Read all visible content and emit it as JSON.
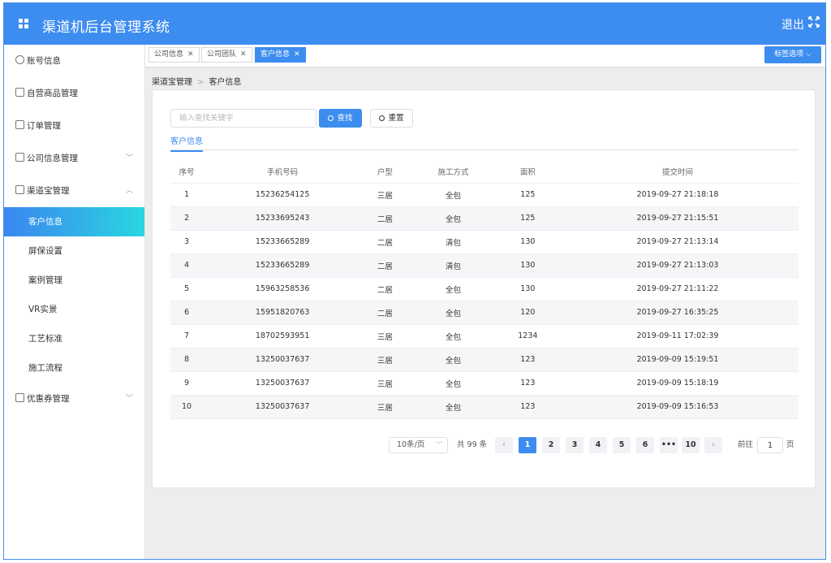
{
  "header": {
    "title": "渠道机后台管理系统",
    "logout_label": "退出"
  },
  "sidebar": {
    "items": [
      {
        "label": "账号信息"
      },
      {
        "label": "自营商品管理"
      },
      {
        "label": "订单管理"
      },
      {
        "label": "公司信息管理"
      },
      {
        "label": "渠道宝管理"
      }
    ],
    "sub_items": [
      {
        "label": "客户信息"
      },
      {
        "label": "屏保设置"
      },
      {
        "label": "案例管理"
      },
      {
        "label": "VR实景"
      },
      {
        "label": "工艺标准"
      },
      {
        "label": "施工流程"
      }
    ],
    "last_item": {
      "label": "优惠券管理"
    }
  },
  "tabs": [
    {
      "label": "公司信息"
    },
    {
      "label": "公司团队"
    },
    {
      "label": "客户信息"
    }
  ],
  "tab_options_label": "标签选项",
  "breadcrumb": {
    "parent": "渠道宝管理",
    "current": "客户信息"
  },
  "search": {
    "placeholder": "输入查找关键字",
    "search_label": "查找",
    "reset_label": "重置"
  },
  "inner_tab": "客户信息",
  "table": {
    "headers": [
      "序号",
      "手机号码",
      "户型",
      "施工方式",
      "面积",
      "提交时间"
    ],
    "rows": [
      [
        "1",
        "15236254125",
        "三居",
        "全包",
        "125",
        "2019-09-27 21:18:18"
      ],
      [
        "2",
        "15233695243",
        "二居",
        "全包",
        "125",
        "2019-09-27 21:15:51"
      ],
      [
        "3",
        "15233665289",
        "二居",
        "清包",
        "130",
        "2019-09-27 21:13:14"
      ],
      [
        "4",
        "15233665289",
        "二居",
        "清包",
        "130",
        "2019-09-27 21:13:03"
      ],
      [
        "5",
        "15963258536",
        "二居",
        "全包",
        "130",
        "2019-09-27 21:11:22"
      ],
      [
        "6",
        "15951820763",
        "二居",
        "全包",
        "120",
        "2019-09-27 16:35:25"
      ],
      [
        "7",
        "18702593951",
        "三居",
        "全包",
        "1234",
        "2019-09-11 17:02:39"
      ],
      [
        "8",
        "13250037637",
        "三居",
        "全包",
        "123",
        "2019-09-09 15:19:51"
      ],
      [
        "9",
        "13250037637",
        "三居",
        "全包",
        "123",
        "2019-09-09 15:18:19"
      ],
      [
        "10",
        "13250037637",
        "三居",
        "全包",
        "123",
        "2019-09-09 15:16:53"
      ]
    ]
  },
  "pagination": {
    "page_size": "10条/页",
    "total": "共 99 条",
    "pages": [
      "1",
      "2",
      "3",
      "4",
      "5",
      "6",
      "•••",
      "10"
    ],
    "current_page": "1",
    "goto_label": "前往",
    "goto_value": "1",
    "page_suffix": "页"
  },
  "colors": {
    "primary": "#3d8df0",
    "gradient_end": "#2ad6e0"
  }
}
